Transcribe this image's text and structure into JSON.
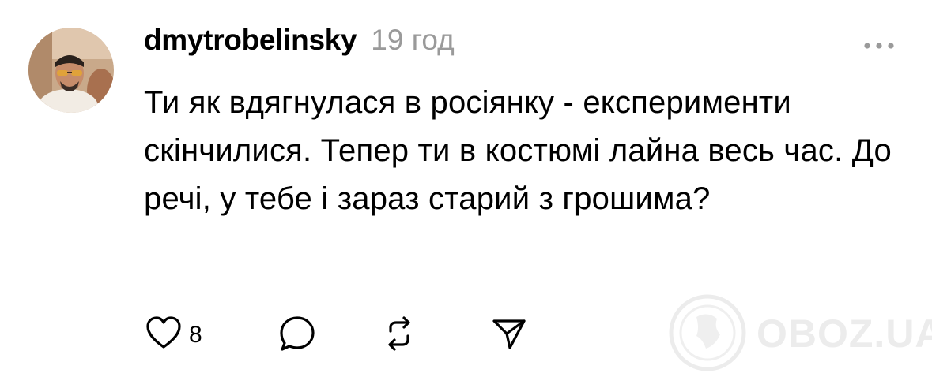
{
  "post": {
    "username": "dmytrobelinsky",
    "timestamp": "19 год",
    "text": "Ти як вдягнулася в росіянку - експерименти скінчилися. Тепер ти в костюмі лайна весь час. До речі, у тебе і зараз старий з грошима?"
  },
  "actions": {
    "like_count": "8",
    "icons": [
      "heart-icon",
      "comment-icon",
      "repost-icon",
      "share-icon"
    ]
  },
  "more_icon": "more-icon",
  "watermark": {
    "text": "OBOZ.UA"
  },
  "colors": {
    "text": "#000000",
    "secondary": "#9a9a9a",
    "watermark": "#ececec"
  }
}
